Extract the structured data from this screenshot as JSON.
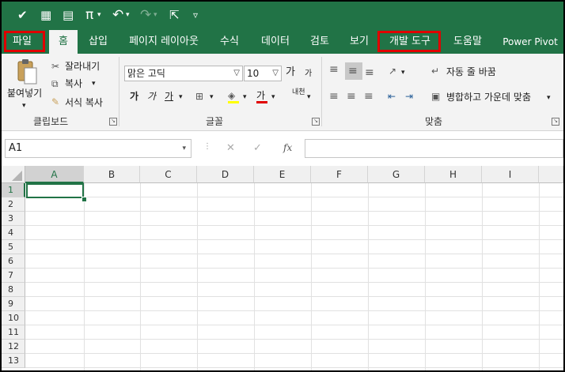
{
  "qat": {
    "icons": [
      "brush-icon",
      "grid-icon",
      "table-icon",
      "pi-icon",
      "undo-icon",
      "redo-icon",
      "pointer-icon",
      "customize-icon"
    ],
    "glyphs": {
      "brush": "✔",
      "grid": "▦",
      "table": "▤",
      "pi": "π",
      "undo": "↶",
      "redo": "↷",
      "pointer": "⇱",
      "customize": "▿"
    }
  },
  "tabs": [
    "파일",
    "홈",
    "삽입",
    "페이지 레이아웃",
    "수식",
    "데이터",
    "검토",
    "보기",
    "개발 도구",
    "도움말",
    "Power Pivot"
  ],
  "active_tab": "홈",
  "highlighted_tabs": [
    "파일",
    "개발 도구"
  ],
  "ribbon": {
    "clipboard": {
      "paste": "붙여넣기",
      "cut": "잘라내기",
      "copy": "복사",
      "format_painter": "서식 복사",
      "label": "클립보드"
    },
    "font": {
      "font_name": "맑은 고딕",
      "font_size": "10",
      "grow": "가",
      "shrink": "가",
      "bold": "가",
      "italic": "가",
      "underline": "가",
      "font_color": "가",
      "phonetic": "내천",
      "label": "글꼴"
    },
    "alignment": {
      "wrap_text": "자동 줄 바꿈",
      "merge_center": "병합하고 가운데 맞춤",
      "label": "맞춤"
    }
  },
  "formula_bar": {
    "name_box": "A1",
    "cancel": "✕",
    "enter": "✓",
    "fx": "fx",
    "value": ""
  },
  "grid": {
    "columns": [
      "A",
      "B",
      "C",
      "D",
      "E",
      "F",
      "G",
      "H",
      "I"
    ],
    "rows": [
      "1",
      "2",
      "3",
      "4",
      "5",
      "6",
      "7",
      "8",
      "9",
      "10",
      "11",
      "12",
      "13"
    ],
    "selected_cell": "A1"
  },
  "colors": {
    "excel_green": "#217346",
    "ribbon_bg": "#f3f3f3",
    "highlight_red": "#e00000"
  }
}
